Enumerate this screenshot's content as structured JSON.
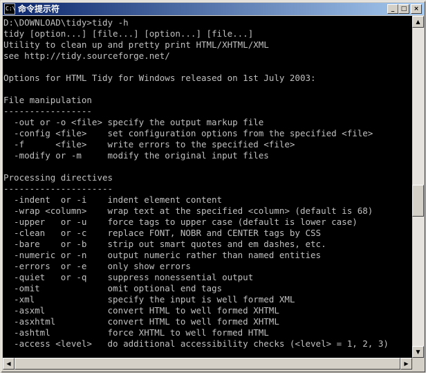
{
  "window": {
    "title": "命令提示符",
    "icon": "cmd-icon",
    "icon_text": "C:\\"
  },
  "title_buttons": {
    "minimize": "_",
    "maximize": "□",
    "close": "×"
  },
  "scrollbars": {
    "up": "▲",
    "down": "▼",
    "left": "◀",
    "right": "▶"
  },
  "console": {
    "lines": [
      "D:\\DOWNLOAD\\tidy>tidy -h",
      "tidy [option...] [file...] [option...] [file...]",
      "Utility to clean up and pretty print HTML/XHTML/XML",
      "see http://tidy.sourceforge.net/",
      "",
      "Options for HTML Tidy for Windows released on 1st July 2003:",
      "",
      "File manipulation",
      "-----------------",
      "  -out or -o <file> specify the output markup file",
      "  -config <file>    set configuration options from the specified <file>",
      "  -f      <file>    write errors to the specified <file>",
      "  -modify or -m     modify the original input files",
      "",
      "Processing directives",
      "---------------------",
      "  -indent  or -i    indent element content",
      "  -wrap <column>    wrap text at the specified <column> (default is 68)",
      "  -upper   or -u    force tags to upper case (default is lower case)",
      "  -clean   or -c    replace FONT, NOBR and CENTER tags by CSS",
      "  -bare    or -b    strip out smart quotes and em dashes, etc.",
      "  -numeric or -n    output numeric rather than named entities",
      "  -errors  or -e    only show errors",
      "  -quiet   or -q    suppress nonessential output",
      "  -omit             omit optional end tags",
      "  -xml              specify the input is well formed XML",
      "  -asxml            convert HTML to well formed XHTML",
      "  -asxhtml          convert HTML to well formed XHTML",
      "  -ashtml           force XHTML to well formed HTML",
      "  -access <level>   do additional accessibility checks (<level> = 1, 2, 3)"
    ]
  }
}
